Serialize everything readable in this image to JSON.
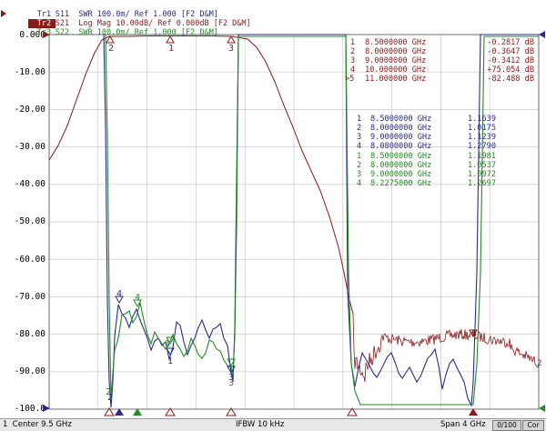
{
  "traces": [
    {
      "id": "Tr1",
      "text": "S11  SWR 100.0m/ Ref 1.000 [F2 D&M]",
      "color": "#2b2b8f",
      "active": false
    },
    {
      "id": "Tr2",
      "text": "S21  Log Mag 10.00dB/ Ref 0.000dB [F2 D&M]",
      "color": "#8b1a1a",
      "active": true
    },
    {
      "id": "Tr3",
      "text": "S22  SWR 100.0m/ Ref 1.000 [F2 D&M]",
      "color": "#228b22",
      "active": false
    }
  ],
  "y_ticks": [
    "0.000",
    "-10.00",
    "-20.00",
    "-30.00",
    "-40.00",
    "-50.00",
    "-60.00",
    "-70.00",
    "-80.00",
    "-90.00",
    "-100.0"
  ],
  "marker_tables": {
    "s21": {
      "color": "#8b1a1a",
      "rows": [
        {
          "id": "1",
          "freq": "8.5000000 GHz",
          "val": "-0.2817 dB"
        },
        {
          "id": "2",
          "freq": "8.0000000 GHz",
          "val": "-0.3647 dB"
        },
        {
          "id": "3",
          "freq": "9.0000000 GHz",
          "val": "-0.3412 dB"
        },
        {
          "id": "4",
          "freq": "10.000000 GHz",
          "val": "+75.054 dB"
        },
        {
          "id": ">5",
          "freq": "11.000000 GHz",
          "val": "-82.488 dB"
        }
      ]
    },
    "s11": {
      "color": "#2b2b8f",
      "rows": [
        {
          "id": "1",
          "freq": "8.5000000 GHz",
          "val": "1.1639"
        },
        {
          "id": "2",
          "freq": "8.0000000 GHz",
          "val": "1.0175"
        },
        {
          "id": "3",
          "freq": "9.0000000 GHz",
          "val": "1.1239"
        },
        {
          "id": "4",
          "freq": "8.0800000 GHz",
          "val": "1.2790"
        }
      ]
    },
    "s22": {
      "color": "#228b22",
      "rows": [
        {
          "id": "1",
          "freq": "8.5000000 GHz",
          "val": "1.1981"
        },
        {
          "id": "2",
          "freq": "8.0000000 GHz",
          "val": "1.0537"
        },
        {
          "id": "3",
          "freq": "9.0000000 GHz",
          "val": "1.0972"
        },
        {
          "id": "4",
          "freq": "8.2275000 GHz",
          "val": "1.2697"
        }
      ]
    }
  },
  "marker_labels": {
    "s21": [
      "1",
      "2",
      "3",
      "5"
    ],
    "s11": [
      "1",
      "2",
      "3",
      "4"
    ],
    "s22": [
      "1",
      "2",
      "3",
      "4"
    ]
  },
  "status": {
    "channel": "1  Center 9.5 GHz",
    "ifbw": "IFBW 10 kHz",
    "span": "Span 4 GHz",
    "counter": "0/100",
    "cor": "Cor"
  },
  "colors": {
    "s11": "#2b2b8f",
    "s21": "#8b1a1a",
    "s22": "#228b22",
    "grid": "#c8c8c8",
    "background": "#ffffff"
  }
}
